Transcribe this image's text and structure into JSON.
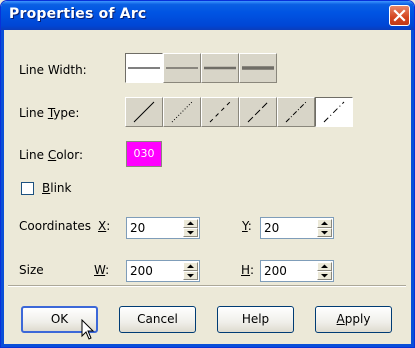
{
  "window": {
    "title": "Properties of Arc"
  },
  "labels": {
    "line_width": "Line Width:",
    "line_type": "Line Type:",
    "line_color": "Line Color:",
    "blink": "Blink",
    "coordinates": "Coordinates",
    "x": "X:",
    "y": "Y:",
    "size": "Size",
    "w": "W:",
    "h": "H:"
  },
  "line_color": {
    "value": "030",
    "hex": "#ff00ff"
  },
  "blink": {
    "checked": false
  },
  "line_width": {
    "options": 4,
    "selected_index": 0
  },
  "line_type": {
    "options": 6,
    "selected_index": 5
  },
  "fields": {
    "x": "20",
    "y": "20",
    "w": "200",
    "h": "200"
  },
  "buttons": {
    "ok": "OK",
    "cancel": "Cancel",
    "help": "Help",
    "apply": "Apply"
  },
  "icons": {
    "close": "close-icon",
    "cursor": "mouse-pointer-icon"
  }
}
